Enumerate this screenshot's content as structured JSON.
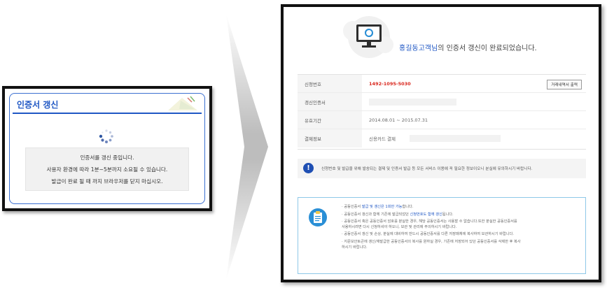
{
  "left_dialog": {
    "title": "인증서 갱신",
    "messages": [
      "인증서를 갱신 중입니다.",
      "사용자 환경에 따라 1분~5분까지 소요될 수 있습니다.",
      "발급이 완료 될 때 까지 브라우저를 닫지 마십시오."
    ]
  },
  "right_panel": {
    "complete_name": "홍길동고객님",
    "complete_suffix": "의 인증서 갱신이 완료되었습니다.",
    "rows": [
      {
        "label": "신청번호",
        "value": "1492-1095-5030"
      },
      {
        "label": "갱신인증서",
        "value": ""
      },
      {
        "label": "유효기간",
        "value": "2014.08.01 ~ 2015.07.31"
      },
      {
        "label": "결제정보",
        "value": "신용카드 결제"
      }
    ],
    "print_button": "거래내역서 출력",
    "notice": "신청번호 및 발급을 위해 발송되는 결제 및 인증서 발급 등 모든 서비스 이용에 꼭 필요한 정보이오니 분실에 유의하시기 바랍니다.",
    "guide_items": [
      {
        "prefix": "공동인증서 ",
        "highlight": "발급 및 갱신은 1회만 가능",
        "suffix": "합니다."
      },
      {
        "prefix": "공동인증서 갱신과 함께 기존에 발급되었던 ",
        "highlight": "신청번호도 함께 갱신",
        "suffix": "됩니다."
      },
      {
        "prefix": "공동인증서 혹은 공동인증서 암호를 분실한 경우, 해당 공동인증서는 사용할 수 없습니다.또한 분실한 공동인증서를\n사용하시려면 다시 신청하셔야 하오니, 보관 및 관리에 주의하시기 바랍니다.",
        "highlight": "",
        "suffix": ""
      },
      {
        "prefix": "공동인증서 갱신 및 손상, 분실에 대비하여 반드시 공동인증서를 다른 저장매체에 복사하여 보관하시기 바랍니다.",
        "highlight": "",
        "suffix": ""
      },
      {
        "prefix": "지문보안토큰에 갱신/재발급한 공동인증서의 복사를 원하실 경우, 기존에 저장되어 있던 공동인증서를 삭제한 후 복사\n하시기 바랍니다.",
        "highlight": "",
        "suffix": ""
      }
    ]
  },
  "colors": {
    "accent_blue": "#1f57c4",
    "value_red": "#d9261c",
    "guide_border": "#8ec8e8"
  },
  "icons": [
    "loading-spinner-icon",
    "monitor-refresh-icon",
    "exclamation-icon",
    "document-icon",
    "arrow-right-icon"
  ]
}
